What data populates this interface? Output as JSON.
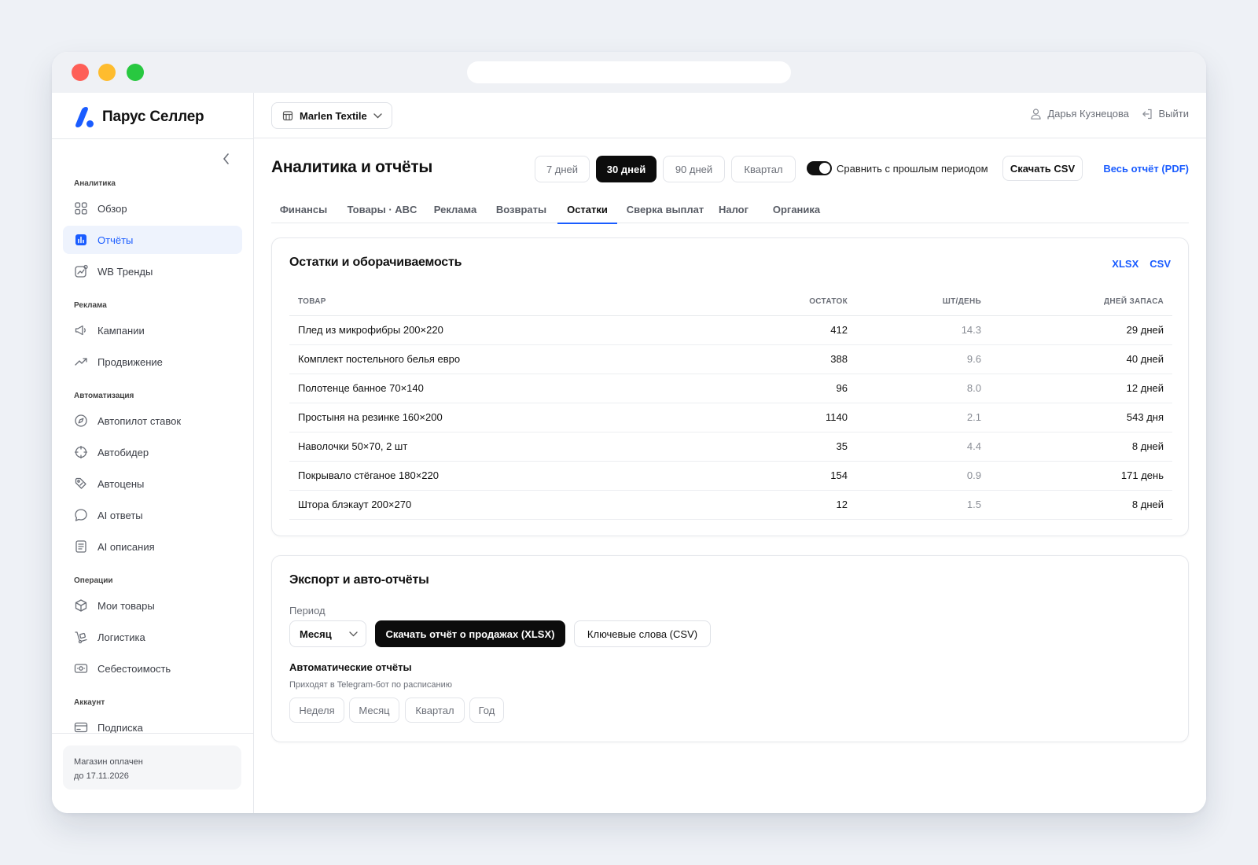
{
  "app": {
    "name": "Парус Селлер"
  },
  "sidebar": {
    "sections": [
      {
        "title": "Аналитика",
        "items": [
          {
            "label": "Обзор",
            "icon": "grid-icon"
          },
          {
            "label": "Отчёты",
            "icon": "chart-icon",
            "active": true
          },
          {
            "label": "WB Тренды",
            "icon": "trend-card-icon"
          }
        ]
      },
      {
        "title": "Реклама",
        "items": [
          {
            "label": "Кампании",
            "icon": "megaphone-icon"
          },
          {
            "label": "Продвижение",
            "icon": "trending-up-icon"
          }
        ]
      },
      {
        "title": "Автоматизация",
        "items": [
          {
            "label": "Автопилот ставок",
            "icon": "compass-icon"
          },
          {
            "label": "Автобидер",
            "icon": "crosshair-icon"
          },
          {
            "label": "Автоцены",
            "icon": "tag-icon"
          },
          {
            "label": "AI ответы",
            "icon": "chat-bubble-icon"
          },
          {
            "label": "AI описания",
            "icon": "document-icon"
          }
        ]
      },
      {
        "title": "Операции",
        "items": [
          {
            "label": "Мои товары",
            "icon": "box-icon"
          },
          {
            "label": "Логистика",
            "icon": "dolly-icon"
          },
          {
            "label": "Себестоимость",
            "icon": "banknote-icon"
          }
        ]
      },
      {
        "title": "Аккаунт",
        "items": [
          {
            "label": "Подписка",
            "icon": "credit-card-icon"
          }
        ]
      }
    ],
    "subscription": {
      "line1": "Магазин оплачен",
      "line2": "до 17.11.2026"
    }
  },
  "topbar": {
    "store": "Marlen Textile",
    "user": "Дарья Кузнецова",
    "logout": "Выйти"
  },
  "page": {
    "title": "Аналитика и отчёты",
    "periods": [
      {
        "label": "7 дней"
      },
      {
        "label": "30 дней",
        "active": true
      },
      {
        "label": "90 дней"
      },
      {
        "label": "Квартал"
      }
    ],
    "compare_label": "Сравнить с прошлым периодом",
    "compare_on": true,
    "download_csv": "Скачать CSV",
    "full_report": "Весь отчёт (PDF)",
    "tabs": [
      {
        "label": "Финансы"
      },
      {
        "label": "Товары · ABC"
      },
      {
        "label": "Реклама"
      },
      {
        "label": "Возвраты"
      },
      {
        "label": "Остатки",
        "active": true
      },
      {
        "label": "Сверка выплат"
      },
      {
        "label": "Налог"
      },
      {
        "label": "Органика"
      }
    ]
  },
  "stock": {
    "title": "Остатки и оборачиваемость",
    "links": [
      "XLSX",
      "CSV"
    ],
    "columns": [
      "ТОВАР",
      "ОСТАТОК",
      "ШТ/ДЕНЬ",
      "ДНЕЙ ЗАПАСА"
    ],
    "rows": [
      [
        "Плед из микрофибры 200×220",
        "412",
        "14.3",
        "29 дней"
      ],
      [
        "Комплект постельного белья евро",
        "388",
        "9.6",
        "40 дней"
      ],
      [
        "Полотенце банное 70×140",
        "96",
        "8.0",
        "12 дней"
      ],
      [
        "Простыня на резинке 160×200",
        "1140",
        "2.1",
        "543 дня"
      ],
      [
        "Наволочки 50×70, 2 шт",
        "35",
        "4.4",
        "8 дней"
      ],
      [
        "Покрывало стёганое 180×220",
        "154",
        "0.9",
        "171 день"
      ],
      [
        "Штора блэкаут 200×270",
        "12",
        "1.5",
        "8 дней"
      ]
    ]
  },
  "export": {
    "title": "Экспорт и авто-отчёты",
    "period_label": "Период",
    "period_value": "Месяц",
    "sales_button": "Скачать отчёт о продажах (XLSX)",
    "keywords_button": "Ключевые слова (CSV)",
    "auto_title": "Автоматические отчёты",
    "auto_subtitle": "Приходят в Telegram-бот по расписанию",
    "schedules": [
      "Неделя",
      "Месяц",
      "Квартал",
      "Год"
    ]
  },
  "colors": {
    "accent": "#1a5cff",
    "primary_button": "#0c0c0c",
    "active_nav_bg": "#eef3fd"
  }
}
